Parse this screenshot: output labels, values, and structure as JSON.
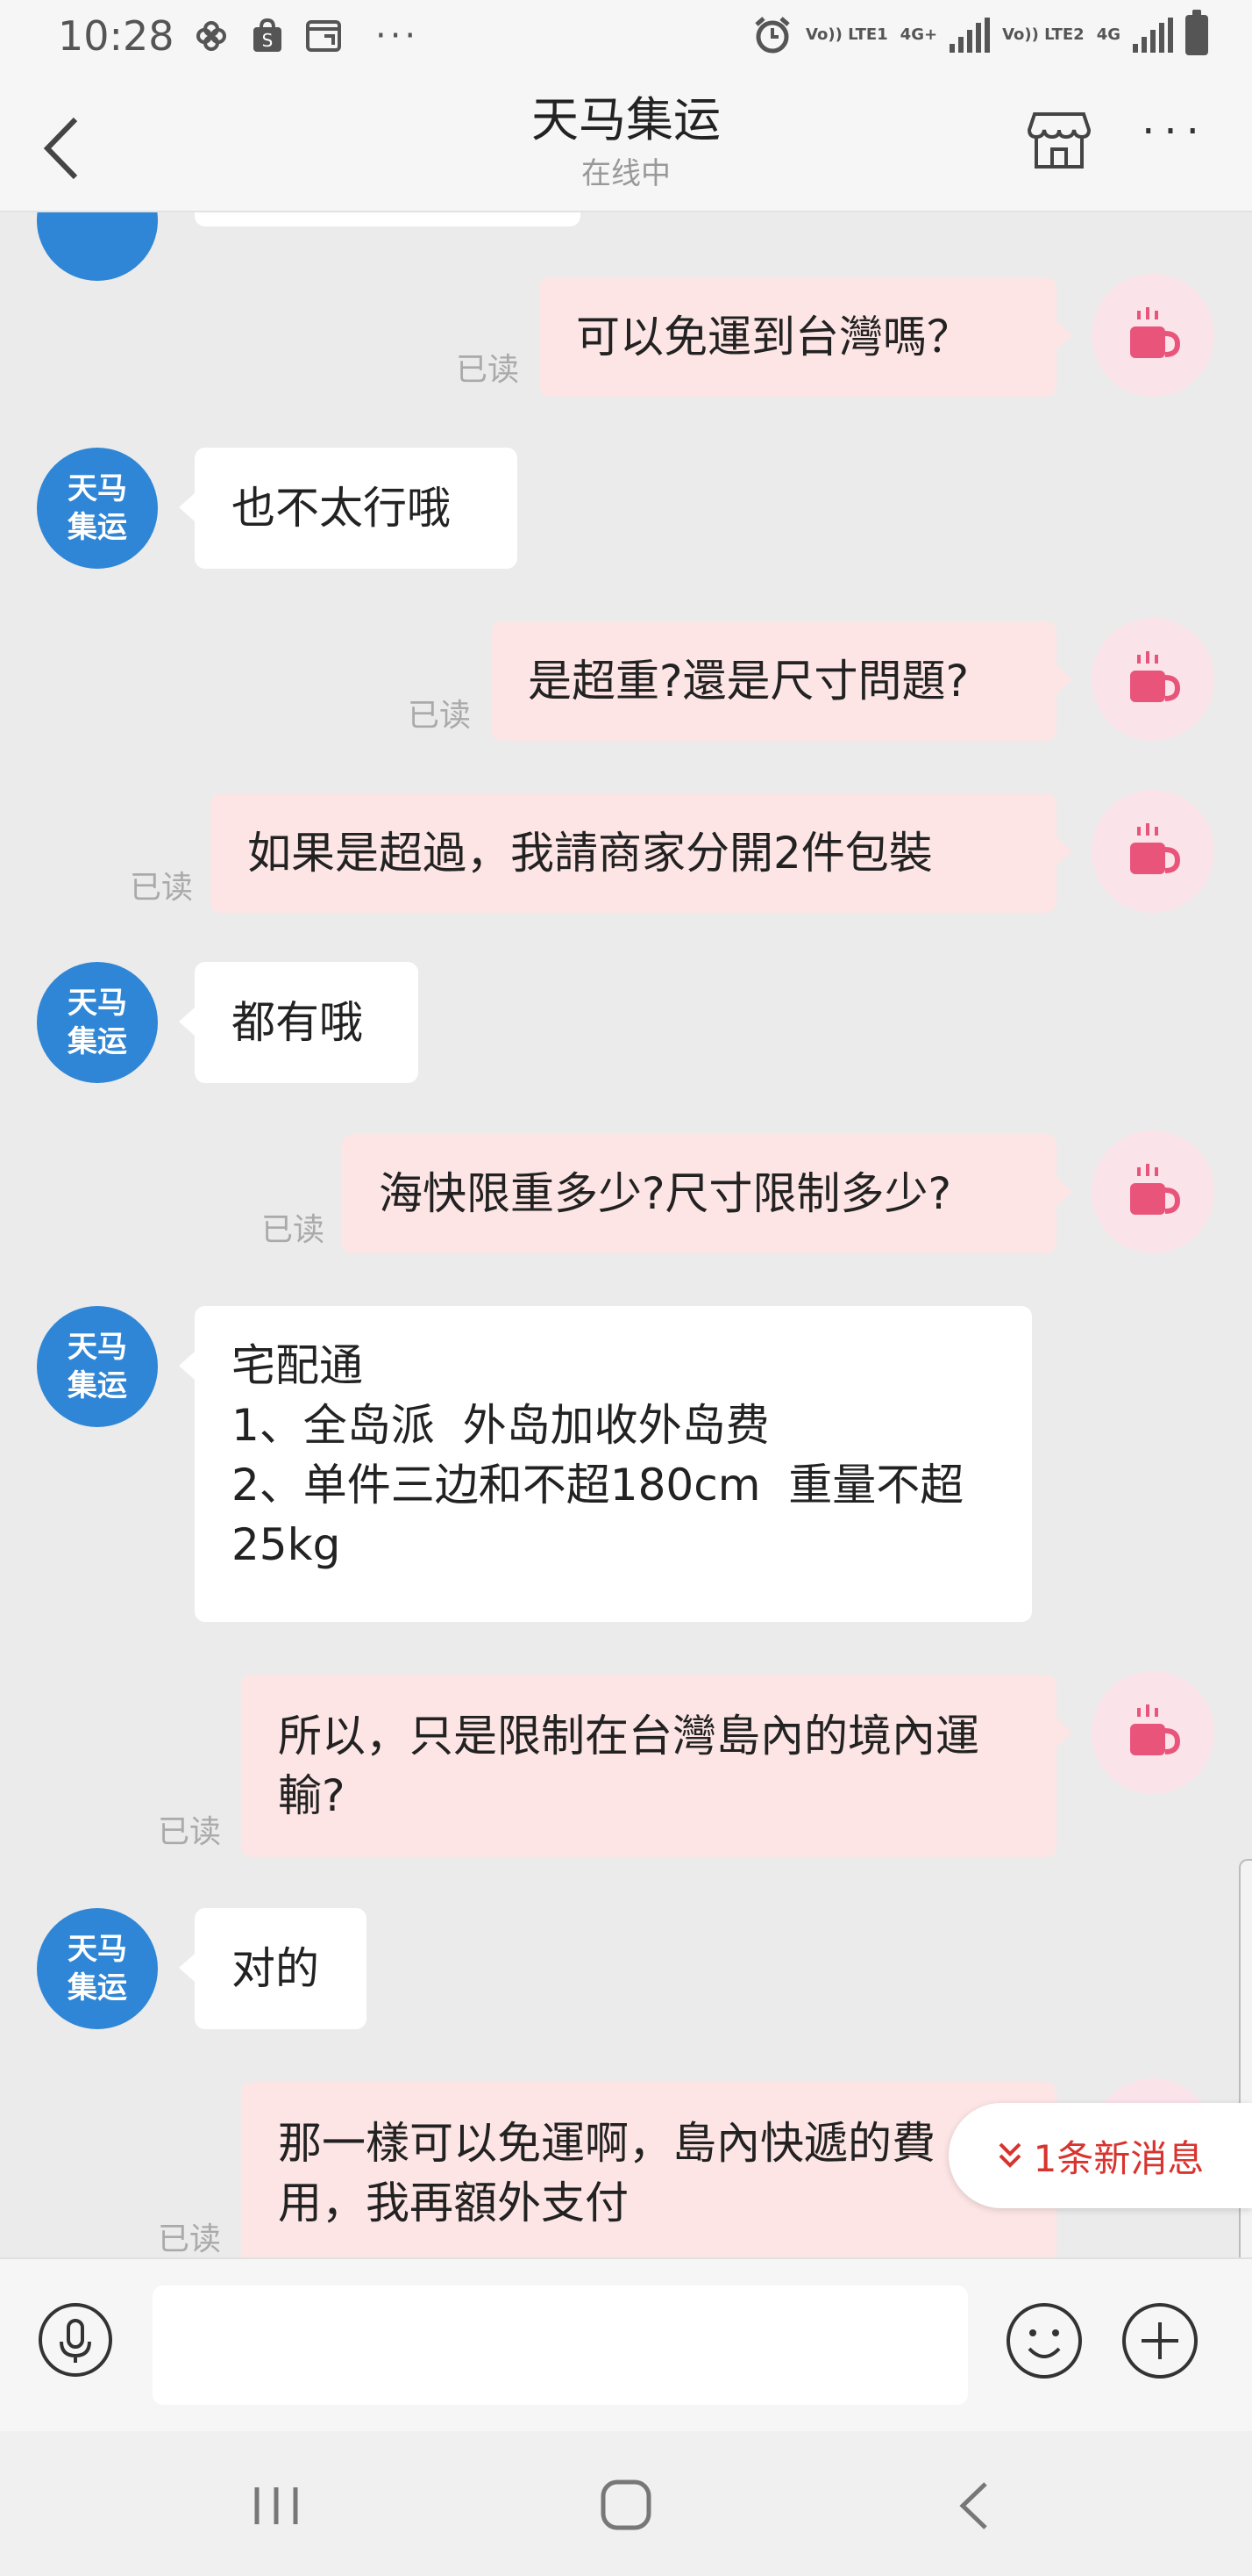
{
  "status_bar": {
    "time": "10:28",
    "sim1": "Vo)) LTE1",
    "sim1_net": "4G+",
    "sim2": "Vo)) LTE2",
    "sim2_net": "4G",
    "more": "···"
  },
  "header": {
    "title": "天马集运",
    "subtitle": "在线中",
    "more": "···"
  },
  "avatar_left_text": [
    "天马",
    "集运"
  ],
  "messages": [
    {
      "side": "right",
      "text": "可以免運到台灣嗎？",
      "read": "已读"
    },
    {
      "side": "left",
      "text": "也不太行哦"
    },
    {
      "side": "right",
      "text": "是超重?還是尺寸問題?",
      "read": "已读"
    },
    {
      "side": "right",
      "text": "如果是超過，我請商家分開2件包裝",
      "read": "已读"
    },
    {
      "side": "left",
      "text": "都有哦"
    },
    {
      "side": "right",
      "text": "海快限重多少?尺寸限制多少?",
      "read": "已读"
    },
    {
      "side": "left",
      "text": "宅配通\n1、全岛派  外岛加收外岛费\n2、单件三边和不超180cm  重量不超25kg"
    },
    {
      "side": "right",
      "text": "所以，只是限制在台灣島內的境內運輸?",
      "read": "已读"
    },
    {
      "side": "left",
      "text": "对的"
    },
    {
      "side": "right",
      "text": "那一樣可以免運啊，島內快遞的費用，我再額外支付",
      "read": "已读"
    }
  ],
  "new_message_pill": "1条新消息",
  "colors": {
    "left_avatar": "#2f86d6",
    "right_bubble": "#fde5e5",
    "left_bubble": "#ffffff",
    "new_message": "#d9332e",
    "background": "#ebebeb"
  }
}
